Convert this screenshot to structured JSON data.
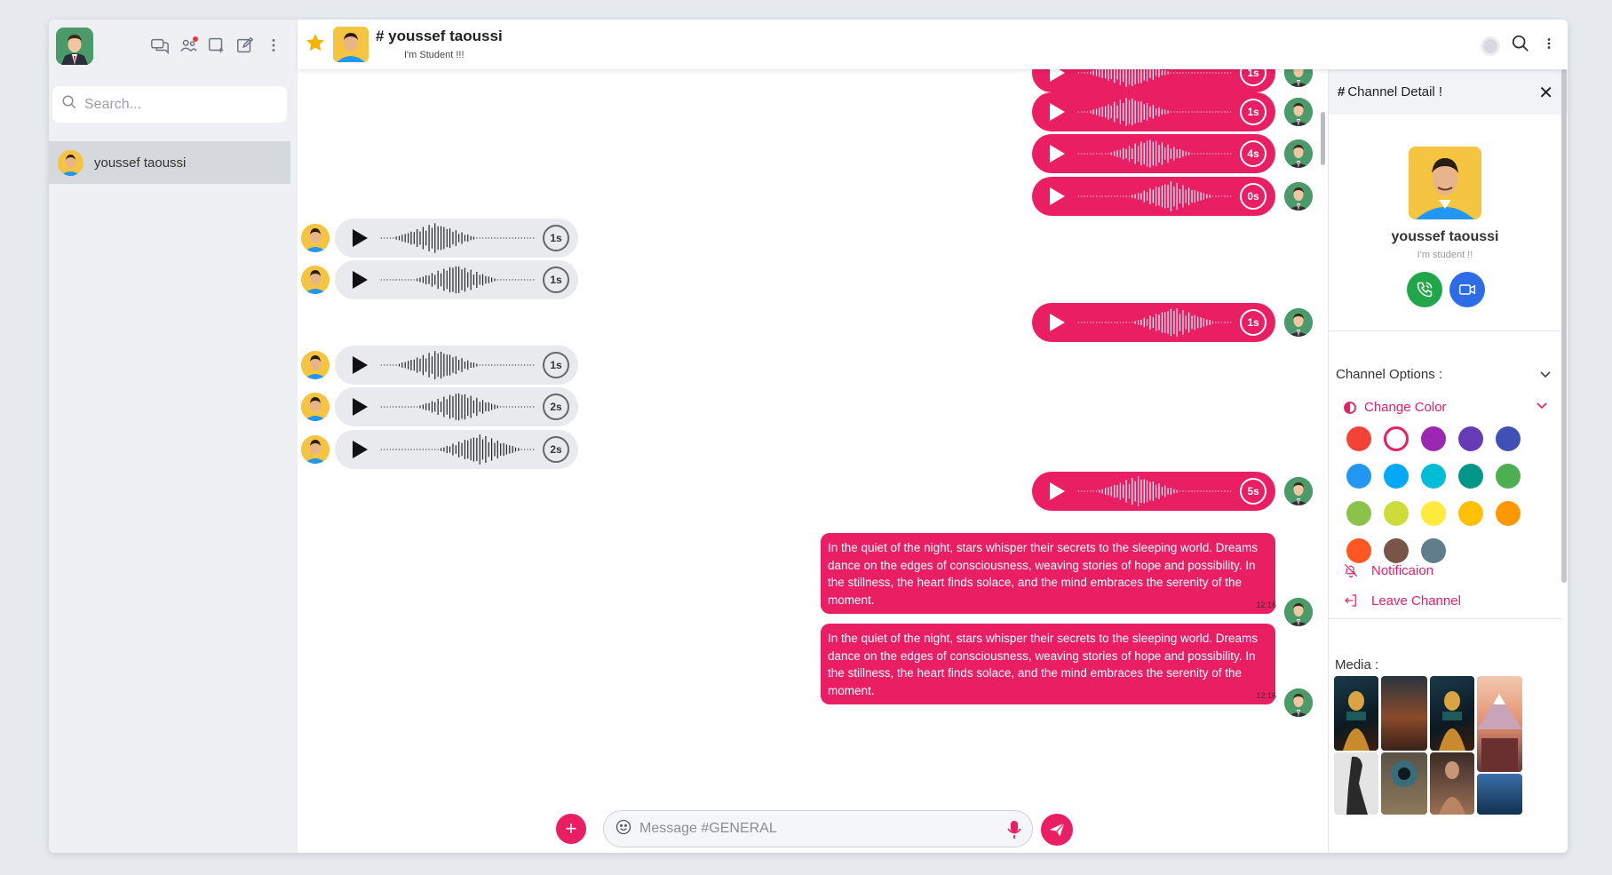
{
  "sidebar": {
    "search_placeholder": "Search...",
    "contacts": [
      {
        "name": "youssef taoussi"
      }
    ],
    "icons": [
      "chat-bubbles-icon",
      "users-icon",
      "add-to-list-icon",
      "edit-icon",
      "more-vertical-icon"
    ]
  },
  "header": {
    "title": "# youssef taoussi",
    "subtitle": "I'm Student !!!"
  },
  "messages": {
    "voice_partial_duration": "1s",
    "voice": [
      {
        "dir": "out",
        "duration": "1s"
      },
      {
        "dir": "out",
        "duration": "4s"
      },
      {
        "dir": "out",
        "duration": "0s"
      },
      {
        "dir": "in",
        "duration": "1s"
      },
      {
        "dir": "in",
        "duration": "1s"
      },
      {
        "dir": "out",
        "duration": "1s"
      },
      {
        "dir": "in",
        "duration": "1s"
      },
      {
        "dir": "in",
        "duration": "2s"
      },
      {
        "dir": "in",
        "duration": "2s"
      },
      {
        "dir": "out",
        "duration": "5s"
      }
    ],
    "texts": [
      {
        "text": "In the quiet of the night, stars whisper their secrets to the sleeping world. Dreams dance on the edges of consciousness, weaving stories of hope and possibility. In the stillness, the heart finds solace, and the mind embraces the serenity of the moment.",
        "time": "12:16"
      },
      {
        "text": "In the quiet of the night, stars whisper their secrets to the sleeping world. Dreams dance on the edges of consciousness, weaving stories of hope and possibility. In the stillness, the heart finds solace, and the mind embraces the serenity of the moment.",
        "time": "12:16"
      }
    ]
  },
  "composer": {
    "placeholder": "Message #GENERAL"
  },
  "detail": {
    "title_hash": "#",
    "title": "Channel Detail !",
    "name": "youssef taoussi",
    "status": "I'm student !!",
    "options_title": "Channel Options :",
    "change_color": "Change Color",
    "notification": "Notificaion",
    "leave": "Leave Channel",
    "media_title": "Media :",
    "accent_color": "#e91e63",
    "colors": [
      "#f44336",
      "#ffffff",
      "#9c27b0",
      "#673ab7",
      "#3f51b5",
      "#2196f3",
      "#03a9f4",
      "#00bcd4",
      "#009688",
      "#4caf50",
      "#8bc34a",
      "#cddc39",
      "#ffeb3b",
      "#ffc107",
      "#ff9800",
      "#ff5722",
      "#795548",
      "#607d8b"
    ]
  }
}
